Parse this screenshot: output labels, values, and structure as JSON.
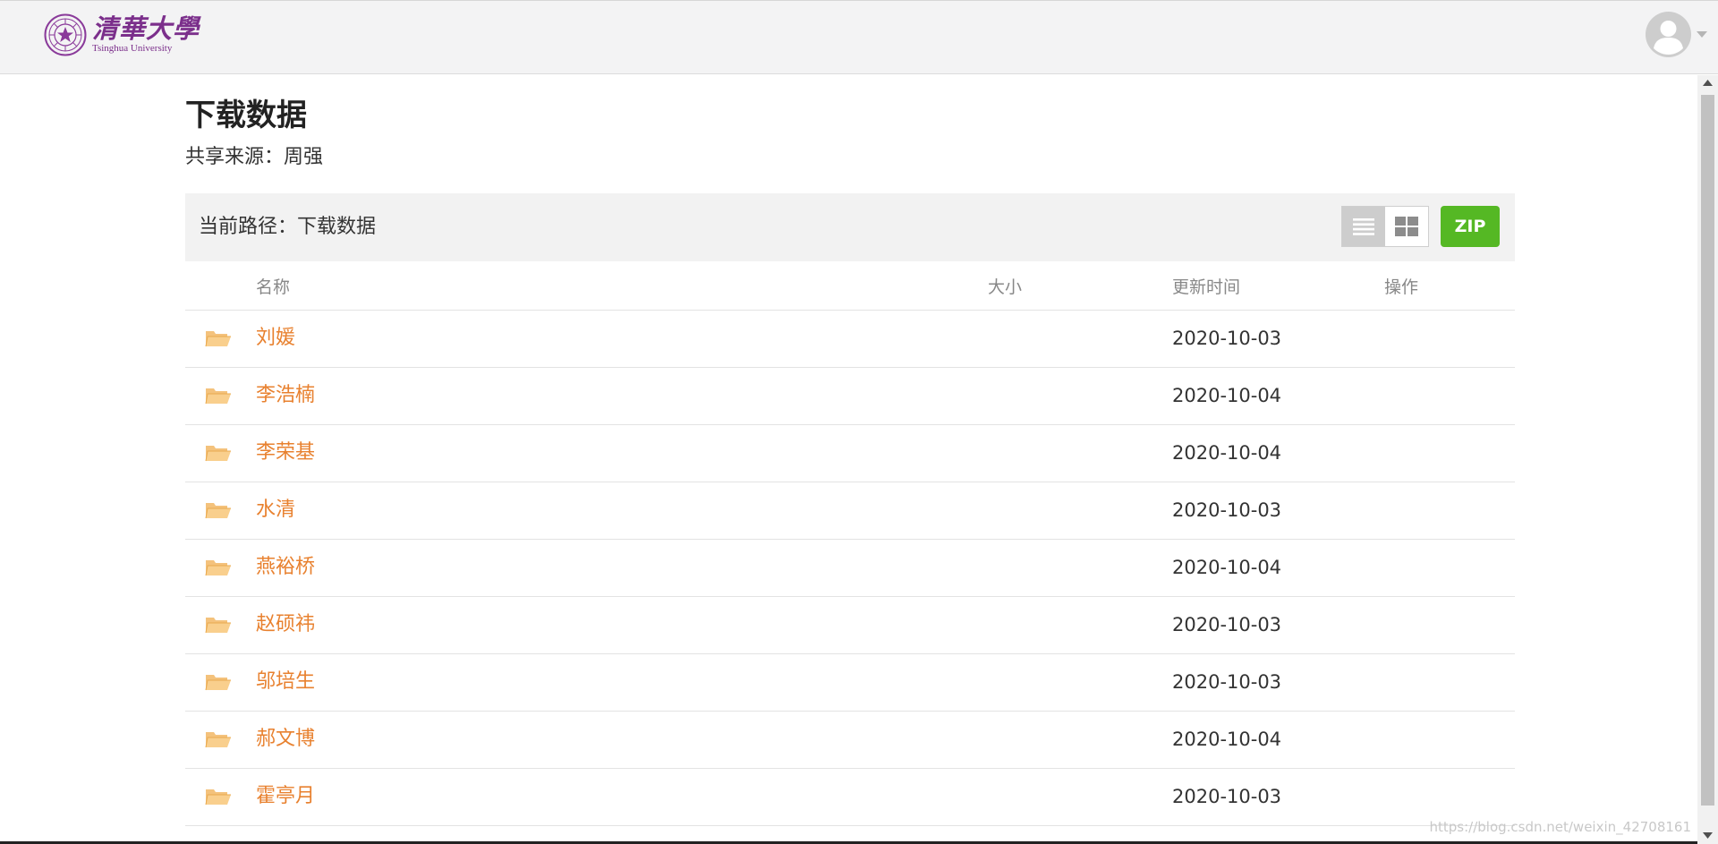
{
  "header": {
    "logo": {
      "name_cn": "清華大學",
      "name_en": "Tsinghua University",
      "brand_color": "#7b2f8b"
    },
    "user_menu": {
      "avatar_icon": "user-avatar-icon",
      "caret_icon": "caret-down-icon"
    }
  },
  "main": {
    "title": "下载数据",
    "share_source": "共享来源：周强",
    "path_bar": {
      "current_path": "当前路径：下载数据",
      "view_list_icon": "list-view-icon",
      "view_grid_icon": "grid-view-icon",
      "zip_label": "ZIP",
      "zip_color": "#55b824"
    },
    "table": {
      "headers": {
        "name": "名称",
        "size": "大小",
        "updated": "更新时间",
        "actions": "操作"
      },
      "rows": [
        {
          "name": "刘媛",
          "size": "",
          "updated": "2020-10-03",
          "actions": ""
        },
        {
          "name": "李浩楠",
          "size": "",
          "updated": "2020-10-04",
          "actions": ""
        },
        {
          "name": "李荣基",
          "size": "",
          "updated": "2020-10-04",
          "actions": ""
        },
        {
          "name": "水清",
          "size": "",
          "updated": "2020-10-03",
          "actions": ""
        },
        {
          "name": "燕裕桥",
          "size": "",
          "updated": "2020-10-04",
          "actions": ""
        },
        {
          "name": "赵硕祎",
          "size": "",
          "updated": "2020-10-03",
          "actions": ""
        },
        {
          "name": "邬培生",
          "size": "",
          "updated": "2020-10-03",
          "actions": ""
        },
        {
          "name": "郝文博",
          "size": "",
          "updated": "2020-10-04",
          "actions": ""
        },
        {
          "name": "霍亭月",
          "size": "",
          "updated": "2020-10-03",
          "actions": ""
        }
      ],
      "folder_icon": "folder-icon",
      "folder_color": "#f6be6e",
      "link_color": "#e8812f"
    }
  },
  "watermark": "https://blog.csdn.net/weixin_42708161"
}
